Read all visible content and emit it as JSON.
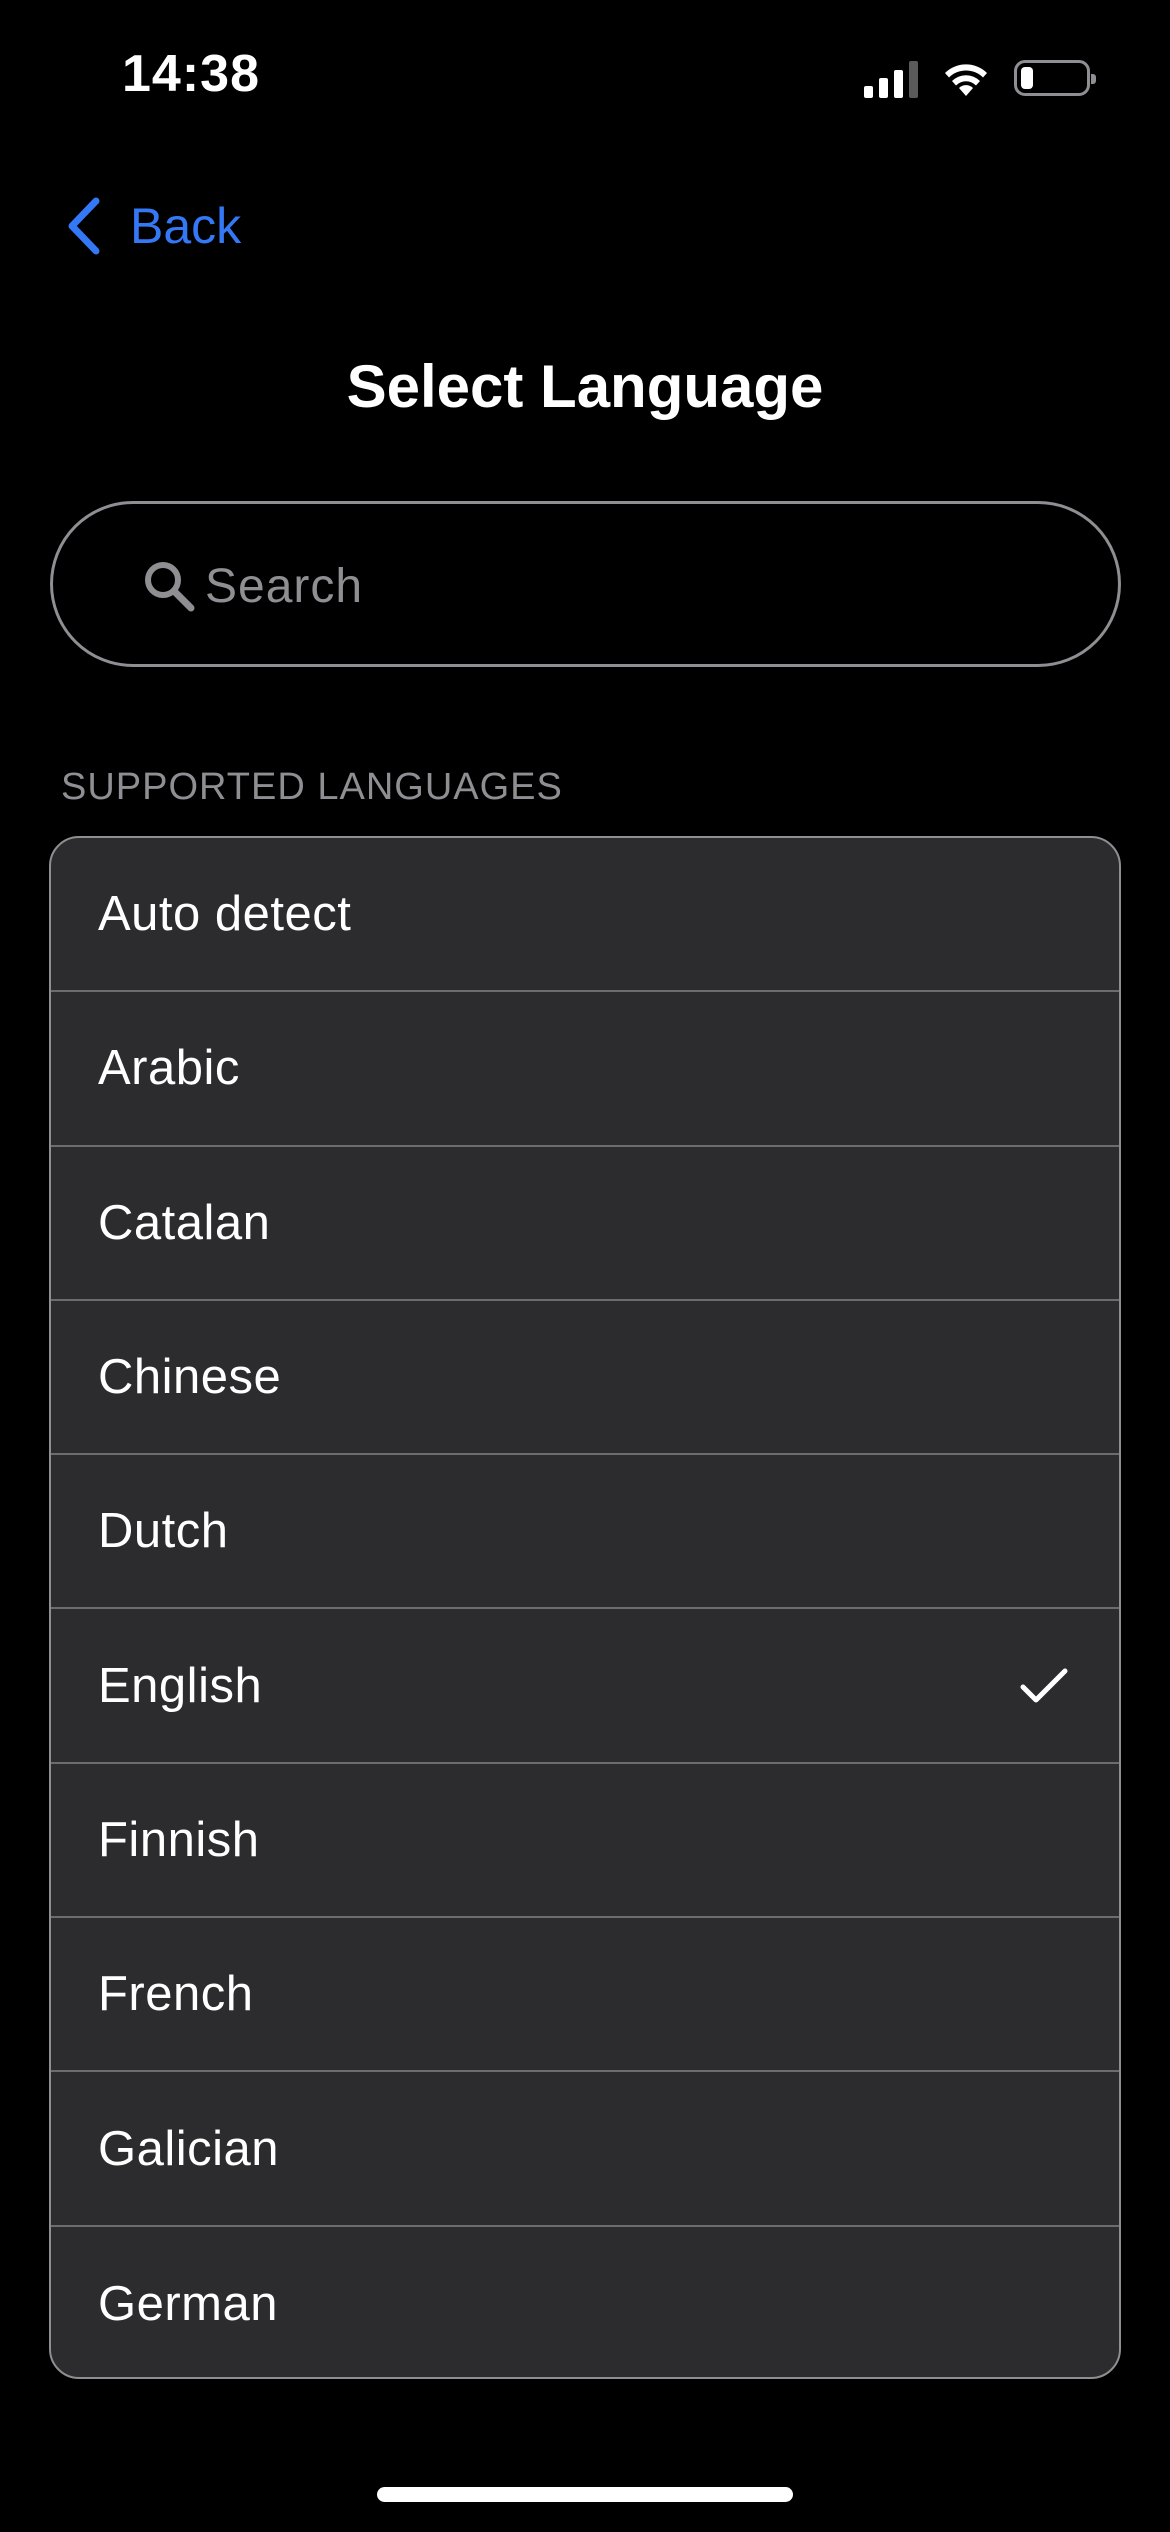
{
  "status_bar": {
    "time": "14:38",
    "icons": [
      "cellular-signal-icon",
      "wifi-icon",
      "battery-icon"
    ],
    "battery_level": 0.2
  },
  "nav": {
    "back_label": "Back",
    "back_icon": "chevron-left-icon"
  },
  "page": {
    "title": "Select Language"
  },
  "search": {
    "placeholder": "Search",
    "value": "",
    "icon": "search-icon"
  },
  "languages": {
    "section_header": "SUPPORTED LANGUAGES",
    "items": [
      {
        "label": "Auto detect",
        "selected": false
      },
      {
        "label": "Arabic",
        "selected": false
      },
      {
        "label": "Catalan",
        "selected": false
      },
      {
        "label": "Chinese",
        "selected": false
      },
      {
        "label": "Dutch",
        "selected": false
      },
      {
        "label": "English",
        "selected": true
      },
      {
        "label": "Finnish",
        "selected": false
      },
      {
        "label": "French",
        "selected": false
      },
      {
        "label": "Galician",
        "selected": false
      },
      {
        "label": "German",
        "selected": false
      }
    ]
  },
  "colors": {
    "accent": "#3478f6",
    "background": "#000000",
    "list_background": "#2c2c2e",
    "secondary_text": "#8e8e93",
    "separator": "#6c6c70"
  }
}
